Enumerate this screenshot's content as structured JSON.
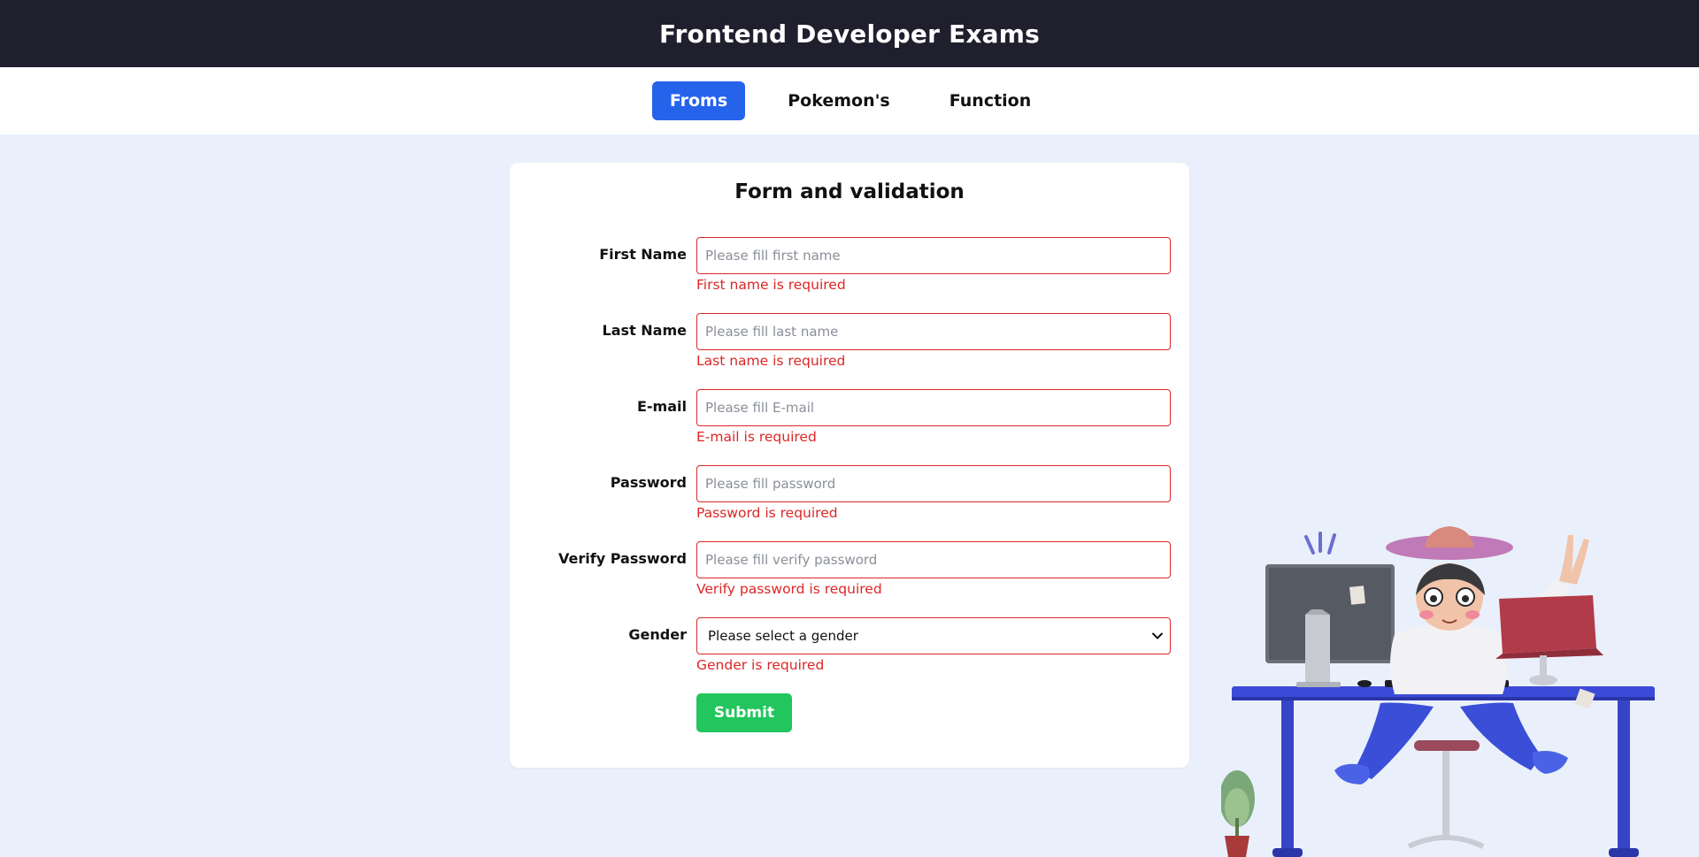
{
  "header": {
    "title": "Frontend Developer Exams"
  },
  "nav": {
    "tabs": [
      {
        "label": "Froms",
        "active": true
      },
      {
        "label": "Pokemon's",
        "active": false
      },
      {
        "label": "Function",
        "active": false
      }
    ]
  },
  "form": {
    "title": "Form and validation",
    "fields": [
      {
        "label": "First Name",
        "value": "",
        "placeholder": "Please fill first name",
        "error": "First name is required"
      },
      {
        "label": "Last Name",
        "value": "",
        "placeholder": "Please fill last name",
        "error": "Last name is required"
      },
      {
        "label": "E-mail",
        "value": "",
        "placeholder": "Please fill E-mail",
        "error": "E-mail is required"
      },
      {
        "label": "Password",
        "value": "",
        "placeholder": "Please fill password",
        "error": "Password is required"
      },
      {
        "label": "Verify Password",
        "value": "",
        "placeholder": "Please fill verify password",
        "error": "Verify password is required"
      }
    ],
    "gender": {
      "label": "Gender",
      "selected": "Please select a gender",
      "error": "Gender is required"
    },
    "submit_label": "Submit"
  },
  "colors": {
    "header_bg": "#1f1f2e",
    "accent": "#2563eb",
    "error": "#dc2626",
    "submit": "#22c55e",
    "page_bg": "#e9f0fb"
  },
  "illustration": {
    "icon": "developer-at-desk-illustration"
  }
}
